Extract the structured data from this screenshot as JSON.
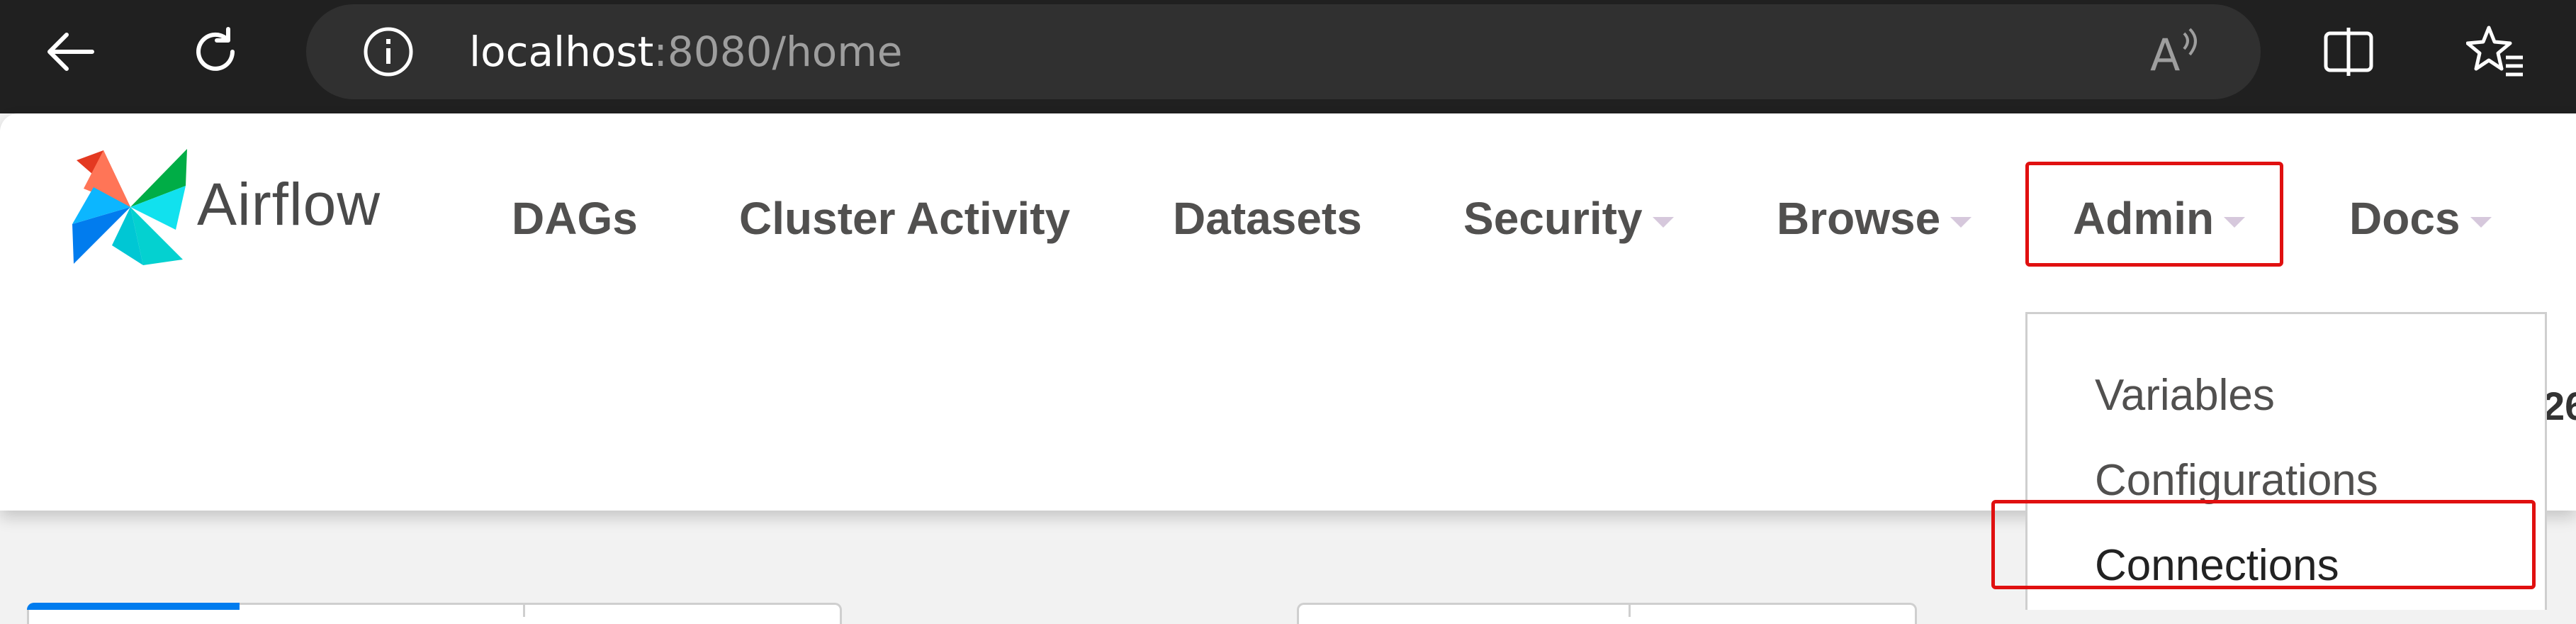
{
  "browser": {
    "url_host": "localhost",
    "url_rest": ":8080/home",
    "icons": [
      "back-arrow-icon",
      "reload-icon",
      "info-icon",
      "read-aloud-icon",
      "split-screen-icon",
      "favorites-icon"
    ]
  },
  "navbar": {
    "brand": "Airflow",
    "items": [
      {
        "label": "DAGs",
        "dropdown": false
      },
      {
        "label": "Cluster Activity",
        "dropdown": false
      },
      {
        "label": "Datasets",
        "dropdown": false
      },
      {
        "label": "Security",
        "dropdown": true
      },
      {
        "label": "Browse",
        "dropdown": true
      },
      {
        "label": "Admin",
        "dropdown": true
      },
      {
        "label": "Docs",
        "dropdown": true
      }
    ]
  },
  "admin_menu": {
    "items": [
      "Variables",
      "Configurations",
      "Connections"
    ]
  },
  "clipped_right_text": "26",
  "colors": {
    "highlight": "#e01010",
    "active_tab": "#017cee",
    "caret": "#d6c8dc"
  }
}
